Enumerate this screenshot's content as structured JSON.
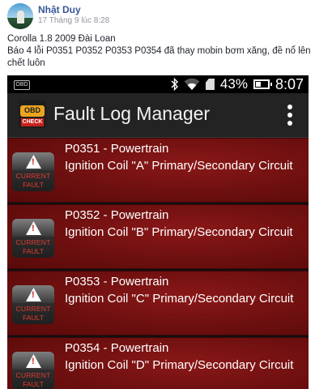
{
  "post": {
    "author": "Nhật Duy",
    "time": "17 Tháng 9 lúc 8:28",
    "lines": [
      "Corolla 1.8 2009 Đài Loan",
      "Báo 4 lỗi P0351 P0352 P0353 P0354 đã thay mobin bơm xăng, đề nổ lên",
      "chết luôn"
    ]
  },
  "status_bar": {
    "left_badge": "OBD",
    "battery_percent": "43%",
    "battery_level": 0.43,
    "clock": "8:07",
    "icons": [
      "bluetooth-icon",
      "wifi-icon",
      "sd-card-icon",
      "battery-icon"
    ]
  },
  "app": {
    "title": "Fault Log Manager",
    "logo_top": "OBD",
    "logo_bottom": "CHECK",
    "menu_icon": "overflow-menu-icon"
  },
  "faults": [
    {
      "code": "P0351 - Powertrain",
      "description": "Ignition Coil \"A\" Primary/Secondary Circuit",
      "badge_line1": "CURRENT",
      "badge_line2": "FAULT"
    },
    {
      "code": "P0352 - Powertrain",
      "description": "Ignition Coil \"B\" Primary/Secondary Circuit",
      "badge_line1": "CURRENT",
      "badge_line2": "FAULT"
    },
    {
      "code": "P0353 - Powertrain",
      "description": "Ignition Coil \"C\" Primary/Secondary Circuit",
      "badge_line1": "CURRENT",
      "badge_line2": "FAULT"
    },
    {
      "code": "P0354 - Powertrain",
      "description": "Ignition Coil \"D\" Primary/Secondary Circuit",
      "badge_line1": "CURRENT",
      "badge_line2": "FAULT"
    }
  ],
  "colors": {
    "row_red": "#7a1212",
    "appbar": "#232323",
    "author_blue": "#385898"
  }
}
